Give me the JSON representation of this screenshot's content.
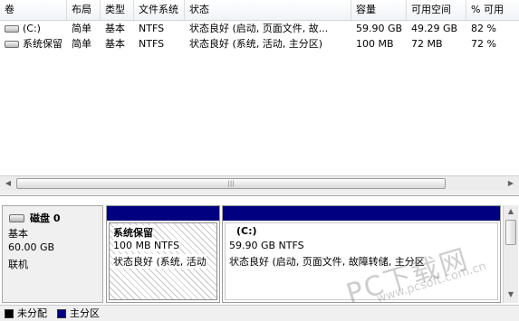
{
  "columns": [
    "卷",
    "布局",
    "类型",
    "文件系统",
    "状态",
    "容量",
    "可用空间",
    "% 可用"
  ],
  "volumes": [
    {
      "name": "(C:)",
      "layout": "简单",
      "type": "基本",
      "fs": "NTFS",
      "status": "状态良好 (启动, 页面文件, 故...",
      "capacity": "59.90 GB",
      "free": "49.29 GB",
      "pct": "82 %"
    },
    {
      "name": "系统保留",
      "layout": "简单",
      "type": "基本",
      "fs": "NTFS",
      "status": "状态良好 (系统, 活动, 主分区)",
      "capacity": "100 MB",
      "free": "72 MB",
      "pct": "72 %"
    }
  ],
  "disk": {
    "name": "磁盘 0",
    "type": "基本",
    "size": "60.00 GB",
    "state": "联机"
  },
  "partitions": [
    {
      "title": "系统保留",
      "size": "100 MB NTFS",
      "status": "状态良好 (系统, 活动"
    },
    {
      "title": "(C:)",
      "size": "59.90 GB NTFS",
      "status": "状态良好 (启动, 页面文件, 故障转储, 主分区"
    }
  ],
  "legend": [
    {
      "label": "未分配",
      "color": "#000000"
    },
    {
      "label": "主分区",
      "color": "#000080"
    }
  ],
  "watermark": {
    "brand": "PC下载网",
    "url": "www.pcsoft.com.cn"
  },
  "icons": {
    "volume": "drive-icon",
    "disk": "disk-icon",
    "scroll_left": "arrow-left-icon",
    "scroll_right": "arrow-right-icon",
    "scroll_up": "arrow-up-icon",
    "scroll_down": "arrow-down-icon"
  }
}
